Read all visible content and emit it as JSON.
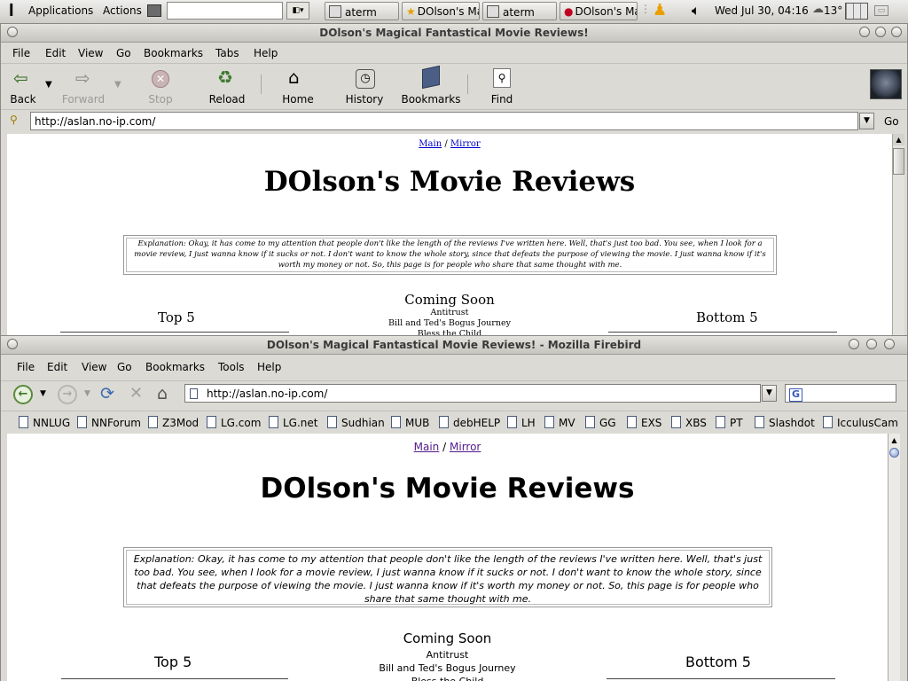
{
  "panel": {
    "applications": "Applications",
    "actions": "Actions",
    "tasks": [
      "aterm",
      "DOlson's Ma",
      "aterm",
      "DOlson's Ma"
    ],
    "clock": "Wed Jul 30, 04:16",
    "temperature": "13°"
  },
  "win1": {
    "title": "DOlson's Magical Fantastical Movie Reviews!",
    "menu": [
      "File",
      "Edit",
      "View",
      "Go",
      "Bookmarks",
      "Tabs",
      "Help"
    ],
    "toolbar": {
      "back": "Back",
      "forward": "Forward",
      "stop": "Stop",
      "reload": "Reload",
      "home": "Home",
      "history": "History",
      "bookmarks": "Bookmarks",
      "find": "Find"
    },
    "url": "http://aslan.no-ip.com/",
    "go": "Go"
  },
  "win2": {
    "title": "DOlson's Magical Fantastical Movie Reviews! - Mozilla Firebird",
    "menu": [
      "File",
      "Edit",
      "View",
      "Go",
      "Bookmarks",
      "Tools",
      "Help"
    ],
    "url": "http://aslan.no-ip.com/",
    "search_glyph": "G",
    "bookmarks": [
      "NNLUG",
      "NNForum",
      "Z3Mod",
      "LG.com",
      "LG.net",
      "Sudhian",
      "MUB",
      "debHELP",
      "LH",
      "MV",
      "GG",
      "EXS",
      "XBS",
      "PT",
      "Slashdot",
      "IcculusCam"
    ]
  },
  "page": {
    "nav_main": "Main",
    "nav_sep": "/",
    "nav_mirror": "Mirror",
    "heading": "DOlson's Movie Reviews",
    "explanation": "Explanation: Okay, it has come to my attention that people don't like the length of the reviews I've written here. Well, that's just too bad. You see, when I look for a movie review, I just wanna know if it sucks or not. I don't want to know the whole story, since that defeats the purpose of viewing the movie. I just wanna know if it's worth my money or not. So, this page is for people who share that same thought with me.",
    "coming_soon": "Coming Soon",
    "coming_list": [
      "Antitrust",
      "Bill and Ted's Bogus Journey",
      "Bless the Child"
    ],
    "top5": "Top 5",
    "bottom5": "Bottom 5"
  }
}
